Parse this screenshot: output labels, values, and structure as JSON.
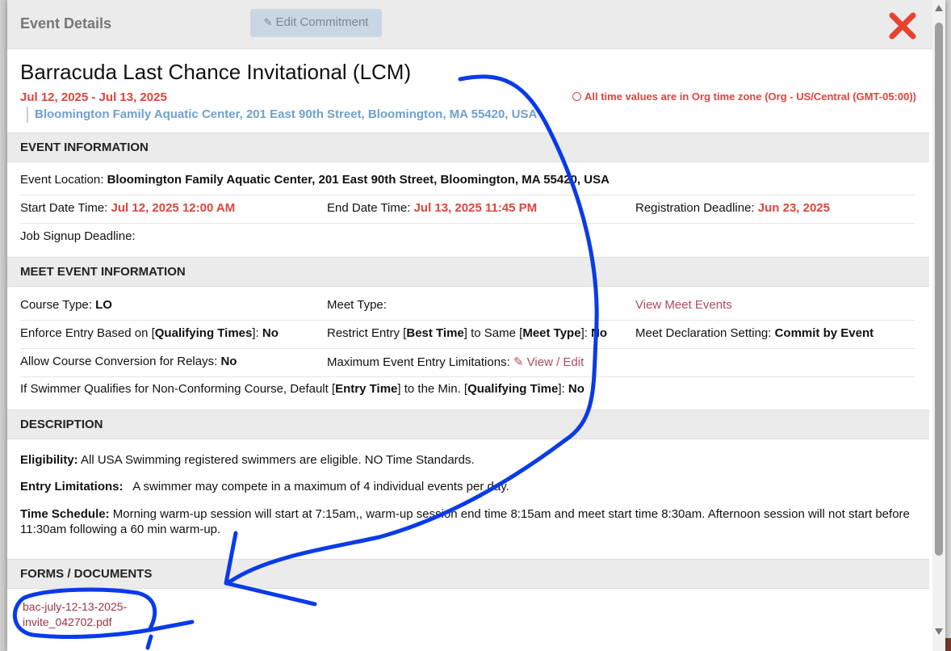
{
  "header": {
    "title": "Event Details",
    "edit_button": "Edit Commitment"
  },
  "event": {
    "name": "Barracuda Last Chance Invitational (LCM)",
    "dates": "Jul 12, 2025 - Jul 13, 2025",
    "location": "Bloomington Family Aquatic Center, 201 East 90th Street, Bloomington, MA 55420, USA",
    "timezone_note": "All time values are in Org time zone (Org - US/Central (GMT-05:00))"
  },
  "event_info": {
    "heading": "EVENT INFORMATION",
    "location_label": "Event Location: ",
    "location_value": "Bloomington Family Aquatic Center, 201 East 90th Street, Bloomington, MA 55420, USA",
    "start_label": "Start Date Time: ",
    "start_value": "Jul 12, 2025 12:00 AM",
    "end_label": "End Date Time: ",
    "end_value": "Jul 13, 2025 11:45 PM",
    "reg_label": "Registration Deadline: ",
    "reg_value": "Jun 23, 2025",
    "job_label": "Job Signup Deadline:"
  },
  "meet_info": {
    "heading": "MEET EVENT INFORMATION",
    "course_label": "Course Type: ",
    "course_value": "LO",
    "meet_type_label": "Meet Type:",
    "view_meet_events": "View Meet Events",
    "enforce_pre": "Enforce Entry Based on [",
    "enforce_bold": "Qualifying Times",
    "enforce_post": "]: ",
    "enforce_value": "No",
    "restrict_pre": "Restrict Entry [",
    "restrict_bold1": "Best Time",
    "restrict_mid": "] to Same [",
    "restrict_bold2": "Meet Type",
    "restrict_post": "]: ",
    "restrict_value": "No",
    "declaration_label": "Meet Declaration Setting: ",
    "declaration_value": "Commit by Event",
    "relay_label": "Allow Course Conversion for Relays: ",
    "relay_value": "No",
    "max_label": "Maximum Event Entry Limitations: ",
    "max_link": "View / Edit",
    "nonconf_pre": "If Swimmer Qualifies for Non-Conforming Course, Default [",
    "nonconf_bold1": "Entry Time",
    "nonconf_mid": "] to the Min. [",
    "nonconf_bold2": "Qualifying Time",
    "nonconf_post": "]: ",
    "nonconf_value": "No"
  },
  "description": {
    "heading": "DESCRIPTION",
    "eligibility_label": "Eligibility:",
    "eligibility_text": " All USA Swimming registered swimmers are eligible. NO Time Standards.",
    "entry_label": "Entry Limitations:",
    "entry_text": "   A swimmer may compete in a maximum of 4 individual events per day.",
    "schedule_label": "Time Schedule:",
    "schedule_text": " Morning warm-up session will start at 7:15am,, warm-up session end time 8:15am and meet start time 8:30am. Afternoon session will not start before 11:30am following a 60 min warm-up."
  },
  "forms": {
    "heading": "FORMS / DOCUMENTS",
    "document": "bac-july-12-13-2025-invite_042702.pdf"
  },
  "colors": {
    "accent_red": "#e0443b",
    "location_blue": "#6ea0d0",
    "annotation_blue": "#0a3be8"
  },
  "icons": [
    "edit-icon",
    "close-icon",
    "clock-icon"
  ]
}
